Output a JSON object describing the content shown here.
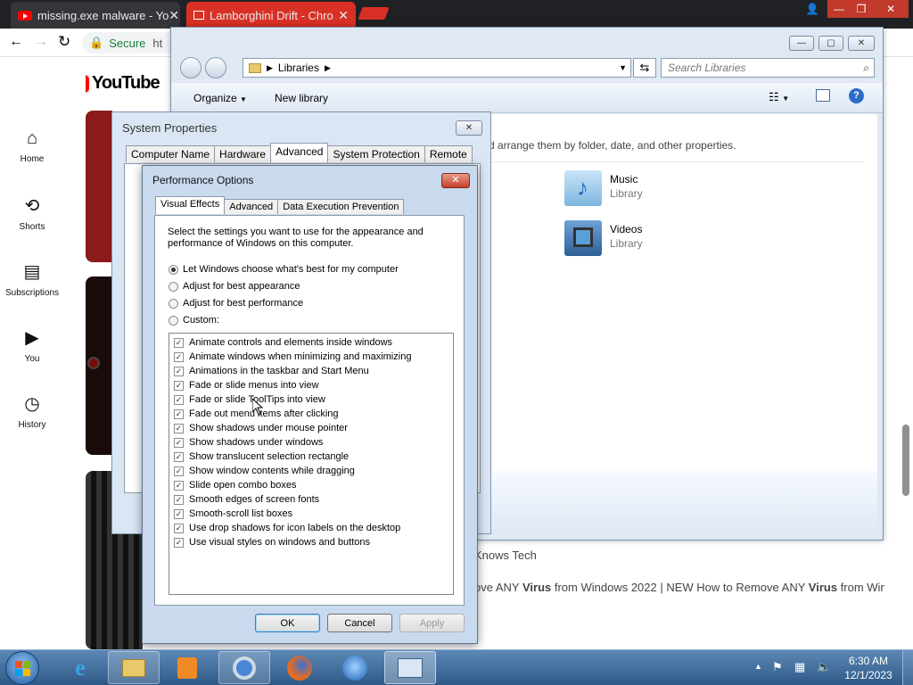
{
  "chrome": {
    "tabs": [
      {
        "title": "missing.exe malware - Yo"
      },
      {
        "title": "Lamborghini Drift - Chro"
      }
    ],
    "address": {
      "secure_label": "Secure",
      "url_fragment": "ht"
    }
  },
  "youtube": {
    "logo_text": "YouTube",
    "nav": [
      {
        "label": "Home",
        "icon": "home-icon"
      },
      {
        "label": "Shorts",
        "icon": "shorts-icon"
      },
      {
        "label": "Subscriptions",
        "icon": "subscriptions-icon"
      },
      {
        "label": "You",
        "icon": "you-icon"
      },
      {
        "label": "History",
        "icon": "history-icon"
      }
    ],
    "channel_fragment": "Knows Tech",
    "video_title_prefix": "ove ANY ",
    "video_title_virus1": "Virus",
    "video_title_mid": " from Windows 2022 | NEW How to Remove ANY ",
    "video_title_virus2": "Virus",
    "video_title_suffix": " from Windo..."
  },
  "explorer": {
    "breadcrumb": "Libraries",
    "search_placeholder": "Search Libraries",
    "toolbar": {
      "organize": "Organize",
      "new_library": "New library"
    },
    "description_fragment": "d arrange them by folder, date, and other properties.",
    "libraries": [
      {
        "name": "Music",
        "type": "Library"
      },
      {
        "name": "Videos",
        "type": "Library"
      }
    ]
  },
  "system_properties": {
    "title": "System Properties",
    "tabs": [
      "Computer Name",
      "Hardware",
      "Advanced",
      "System Protection",
      "Remote"
    ],
    "active_tab": "Advanced"
  },
  "performance_options": {
    "title": "Performance Options",
    "tabs": [
      "Visual Effects",
      "Advanced",
      "Data Execution Prevention"
    ],
    "description": "Select the settings you want to use for the appearance and performance of Windows on this computer.",
    "radios": [
      {
        "label": "Let Windows choose what's best for my computer",
        "selected": true
      },
      {
        "label": "Adjust for best appearance",
        "selected": false
      },
      {
        "label": "Adjust for best performance",
        "selected": false
      },
      {
        "label": "Custom:",
        "selected": false
      }
    ],
    "effects": [
      "Animate controls and elements inside windows",
      "Animate windows when minimizing and maximizing",
      "Animations in the taskbar and Start Menu",
      "Fade or slide menus into view",
      "Fade or slide ToolTips into view",
      "Fade out menu items after clicking",
      "Show shadows under mouse pointer",
      "Show shadows under windows",
      "Show translucent selection rectangle",
      "Show window contents while dragging",
      "Slide open combo boxes",
      "Smooth edges of screen fonts",
      "Smooth-scroll list boxes",
      "Use drop shadows for icon labels on the desktop",
      "Use visual styles on windows and buttons"
    ],
    "buttons": {
      "ok": "OK",
      "cancel": "Cancel",
      "apply": "Apply"
    }
  },
  "taskbar": {
    "time": "6:30 AM",
    "date": "12/1/2023"
  }
}
